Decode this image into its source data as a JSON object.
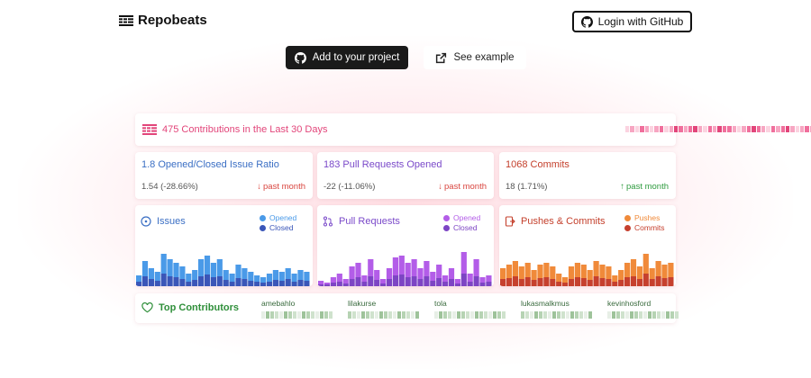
{
  "header": {
    "logo_text": "Repobeats",
    "login_label": "Login with GitHub"
  },
  "actions": {
    "add_label": "Add to your project",
    "example_label": "See example"
  },
  "contributions": {
    "title": "475 Contributions in the Last 30 Days",
    "accent": "#e2457a"
  },
  "stats": [
    {
      "title": "1.8 Opened/Closed Issue Ratio",
      "sub": "1.54 (-28.66%)",
      "trend": "past month",
      "direction": "down",
      "color": "#3b6fc4",
      "trend_color": "#d9453f"
    },
    {
      "title": "183 Pull Requests Opened",
      "sub": "-22 (-11.06%)",
      "trend": "past month",
      "direction": "down",
      "color": "#7a49c9",
      "trend_color": "#d9453f"
    },
    {
      "title": "1068 Commits",
      "sub": "18 (1.71%)",
      "trend": "past month",
      "direction": "up",
      "color": "#c4402c",
      "trend_color": "#2f9b3f"
    }
  ],
  "charts": [
    {
      "title": "Issues",
      "icon": "issue-icon",
      "color": "#3b6fc4",
      "legend": [
        "Opened",
        "Closed"
      ],
      "colors": [
        "#4a9ae8",
        "#3a56b8"
      ]
    },
    {
      "title": "Pull Requests",
      "icon": "pull-request-icon",
      "color": "#7a49c9",
      "legend": [
        "Opened",
        "Closed"
      ],
      "colors": [
        "#b35de8",
        "#7d45c4"
      ]
    },
    {
      "title": "Pushes & Commits",
      "icon": "push-icon",
      "color": "#c4402c",
      "legend": [
        "Pushes",
        "Commits"
      ],
      "colors": [
        "#f08a3a",
        "#c6402e"
      ]
    }
  ],
  "top_contributors": {
    "title": "Top Contributors",
    "names": [
      "amebahlo",
      "lilakurse",
      "tola",
      "lukasmalkmus",
      "kevinhosford"
    ]
  }
}
